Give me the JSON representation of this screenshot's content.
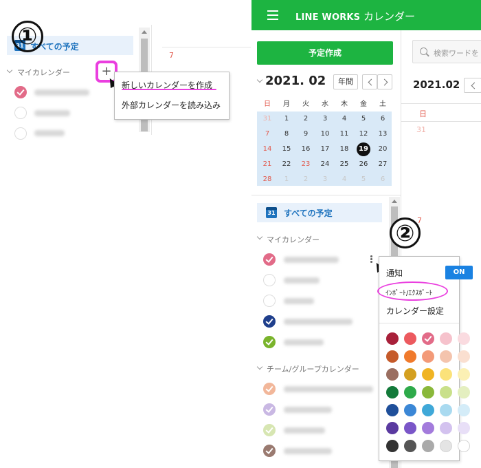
{
  "left": {
    "marker": "①",
    "all_schedules": "すべての予定",
    "cal_icon_text": "31",
    "my_calendar": "マイカレンダー",
    "plus": "+",
    "menu": {
      "create": "新しいカレンダーを作成",
      "import": "外部カレンダーを読み込み"
    },
    "grid_day": "7",
    "calendars": [
      {
        "color": "#e26b88",
        "checked": true
      },
      {
        "color": "#dddddd",
        "checked": false
      },
      {
        "color": "#dddddd",
        "checked": false
      }
    ]
  },
  "right": {
    "brand_en": "LINE WORKS",
    "brand_ja": "カレンダー",
    "create_button": "予定作成",
    "search_placeholder": "検索ワードを",
    "month": "2021. 02",
    "year_button": "年間",
    "month_short": "2021.02",
    "sunday_label": "日",
    "main_grid_day_top": "31",
    "main_grid_day_mid": "7",
    "weekdays": [
      "日",
      "月",
      "火",
      "水",
      "木",
      "金",
      "土"
    ],
    "weeks": [
      [
        {
          "d": "31",
          "o": true
        },
        {
          "d": "1"
        },
        {
          "d": "2"
        },
        {
          "d": "3"
        },
        {
          "d": "4"
        },
        {
          "d": "5"
        },
        {
          "d": "6"
        }
      ],
      [
        {
          "d": "7"
        },
        {
          "d": "8"
        },
        {
          "d": "9"
        },
        {
          "d": "10"
        },
        {
          "d": "11"
        },
        {
          "d": "12"
        },
        {
          "d": "13"
        }
      ],
      [
        {
          "d": "14"
        },
        {
          "d": "15"
        },
        {
          "d": "16"
        },
        {
          "d": "17"
        },
        {
          "d": "18"
        },
        {
          "d": "19",
          "today": true
        },
        {
          "d": "20"
        }
      ],
      [
        {
          "d": "21"
        },
        {
          "d": "22"
        },
        {
          "d": "23",
          "holiday": true
        },
        {
          "d": "24"
        },
        {
          "d": "25"
        },
        {
          "d": "26"
        },
        {
          "d": "27"
        }
      ],
      [
        {
          "d": "28"
        },
        {
          "d": "1",
          "o": true
        },
        {
          "d": "2",
          "o": true
        },
        {
          "d": "3",
          "o": true
        },
        {
          "d": "4",
          "o": true
        },
        {
          "d": "5",
          "o": true
        },
        {
          "d": "6",
          "o": true
        }
      ]
    ],
    "all_schedules": "すべての予定",
    "cal_icon_text": "31",
    "my_calendar": "マイカレンダー",
    "team_calendar": "チーム/グループカレンダー",
    "marker": "②",
    "calendars": [
      {
        "color": "#e26b88",
        "checked": true
      },
      {
        "color": "#dddddd",
        "checked": false
      },
      {
        "color": "#dddddd",
        "checked": false
      },
      {
        "color": "#1f3f8c",
        "checked": true
      },
      {
        "color": "#7ab42c",
        "checked": true
      }
    ],
    "team_calendars": [
      {
        "color": "#f2b79a",
        "checked": true
      },
      {
        "color": "#c9b8e3",
        "checked": true
      },
      {
        "color": "#d7e6b2",
        "checked": true
      },
      {
        "color": "#9a7a70",
        "checked": true
      }
    ],
    "menu": {
      "notify": "通知",
      "toggle": "ON",
      "import_export": "ｲﾝﾎﾟｰﾄ/ｴｸｽﾎﾟｰﾄ",
      "settings": "カレンダー設定"
    },
    "palette": [
      [
        "#a8203a",
        "#ec5a5f",
        "#e26b88",
        "#f6c2cc",
        "#fadbe0"
      ],
      [
        "#c55a2a",
        "#f07a2c",
        "#f39a78",
        "#f4c4ad",
        "#fadfd0"
      ],
      [
        "#9a6e60",
        "#d4a020",
        "#f0b423",
        "#fbe27a",
        "#fbf0b4"
      ],
      [
        "#137a3a",
        "#2eaa4a",
        "#8ab83a",
        "#c9e08a",
        "#e4efc0"
      ],
      [
        "#1f4f9a",
        "#3b87d6",
        "#3fa8d8",
        "#a9daf0",
        "#d4ecf8"
      ],
      [
        "#5a3aa0",
        "#7a56c8",
        "#a37bdc",
        "#d3c2ef",
        "#e8dff7"
      ],
      [
        "#333333",
        "#555555",
        "#aaaaaa",
        "#e4e4e4",
        "#ffffff"
      ]
    ],
    "selected_swatch": [
      0,
      2
    ]
  }
}
